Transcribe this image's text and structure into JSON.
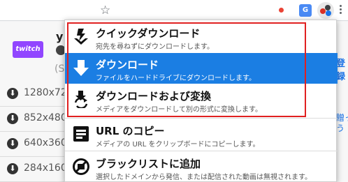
{
  "toolbar": {
    "star_icon": "star-icon",
    "translate_label": "G"
  },
  "page": {
    "title": "y",
    "subtitle": "(S",
    "logo_text": "twitch",
    "resolutions": [
      "1280x72",
      "852x480",
      "640x360",
      "284x160"
    ],
    "right_edge_a": "登録",
    "right_edge_b": "贈っ\nう"
  },
  "menu": {
    "items": [
      {
        "title": "クイックダウンロード",
        "desc": "宛先を尋ねずにダウンロードします。",
        "icon": "quick-download-icon"
      },
      {
        "title": "ダウンロード",
        "desc": "ファイルをハードドライブにダウンロードします。",
        "icon": "download-icon"
      },
      {
        "title": "ダウンロードおよび変換",
        "desc": "メディアをダウンロードして別の形式に変換します。",
        "icon": "download-convert-icon"
      },
      {
        "title": "URL のコピー",
        "desc": "メディアの URL をクリップボードにコピーします。",
        "icon": "copy-url-icon"
      },
      {
        "title": "ブラックリストに追加",
        "desc": "選択したドメインから発信、または配信された動画は無視されます。",
        "icon": "blacklist-icon"
      }
    ],
    "selected_index": 1
  },
  "colors": {
    "selected_bg": "#1b7ee3",
    "highlight_border": "#e02020",
    "twitch_purple": "#9146ff"
  }
}
